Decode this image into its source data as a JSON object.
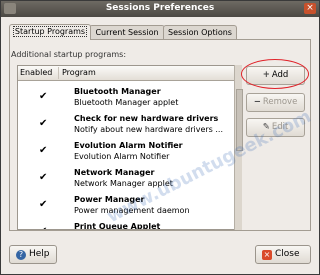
{
  "window": {
    "title": "Sessions Preferences"
  },
  "tabs": [
    {
      "label": "Startup Programs",
      "active": true
    },
    {
      "label": "Current Session",
      "active": false
    },
    {
      "label": "Session Options",
      "active": false
    }
  ],
  "startup": {
    "section_label": "Additional startup programs:",
    "columns": {
      "enabled": "Enabled",
      "program": "Program"
    },
    "rows": [
      {
        "enabled": true,
        "name": "Bluetooth Manager",
        "desc": "Bluetooth Manager applet"
      },
      {
        "enabled": true,
        "name": "Check for new hardware drivers",
        "desc": "Notify about new hardware drivers ..."
      },
      {
        "enabled": true,
        "name": "Evolution Alarm Notifier",
        "desc": "Evolution Alarm Notifier"
      },
      {
        "enabled": true,
        "name": "Network Manager",
        "desc": "Network Manager applet"
      },
      {
        "enabled": true,
        "name": "Power Manager",
        "desc": "Power management daemon"
      },
      {
        "enabled": true,
        "name": "Print Queue Applet",
        "desc": ""
      }
    ]
  },
  "buttons": {
    "add": "Add",
    "remove": "Remove",
    "edit": "Edit",
    "help": "Help",
    "close": "Close"
  },
  "watermark": "www.ubuntugeek.com",
  "colors": {
    "titlebar": "#5b5852",
    "highlight": "#e0232a",
    "background": "#efebe7"
  }
}
